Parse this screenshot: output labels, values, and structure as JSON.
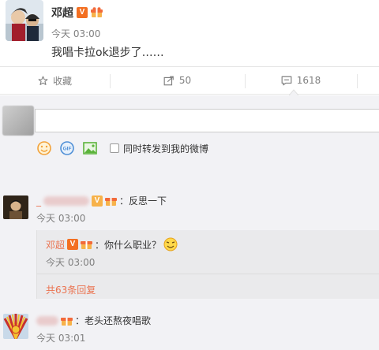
{
  "post": {
    "author": "邓超",
    "verified_badge": "V",
    "time": "今天 03:00",
    "text": "我唱卡拉ok退步了……"
  },
  "actions": {
    "favorite_label": "收藏",
    "forward_count": "50",
    "comment_count": "1618"
  },
  "composer": {
    "forward_checkbox_label": "同时转发到我的微博"
  },
  "comments": [
    {
      "name_prefix": "_",
      "text": "：反思一下",
      "time": "今天 03:00",
      "reply": {
        "name": "邓超",
        "text": "：你什么职业？",
        "time": "今天 03:00",
        "more": "共63条回复"
      }
    },
    {
      "text": "：老头还熬夜唱歌",
      "time": "今天 03:01"
    }
  ],
  "colors": {
    "accent_orange": "#eb7350",
    "verified_orange": "#f36f21",
    "comment_bg": "#f2f2f5",
    "muted_text": "#808080"
  },
  "icons": [
    "star-icon",
    "forward-icon",
    "comment-icon",
    "emoji-icon",
    "gif-icon",
    "image-icon",
    "gift-badge-icon",
    "smile-emoji-icon"
  ]
}
